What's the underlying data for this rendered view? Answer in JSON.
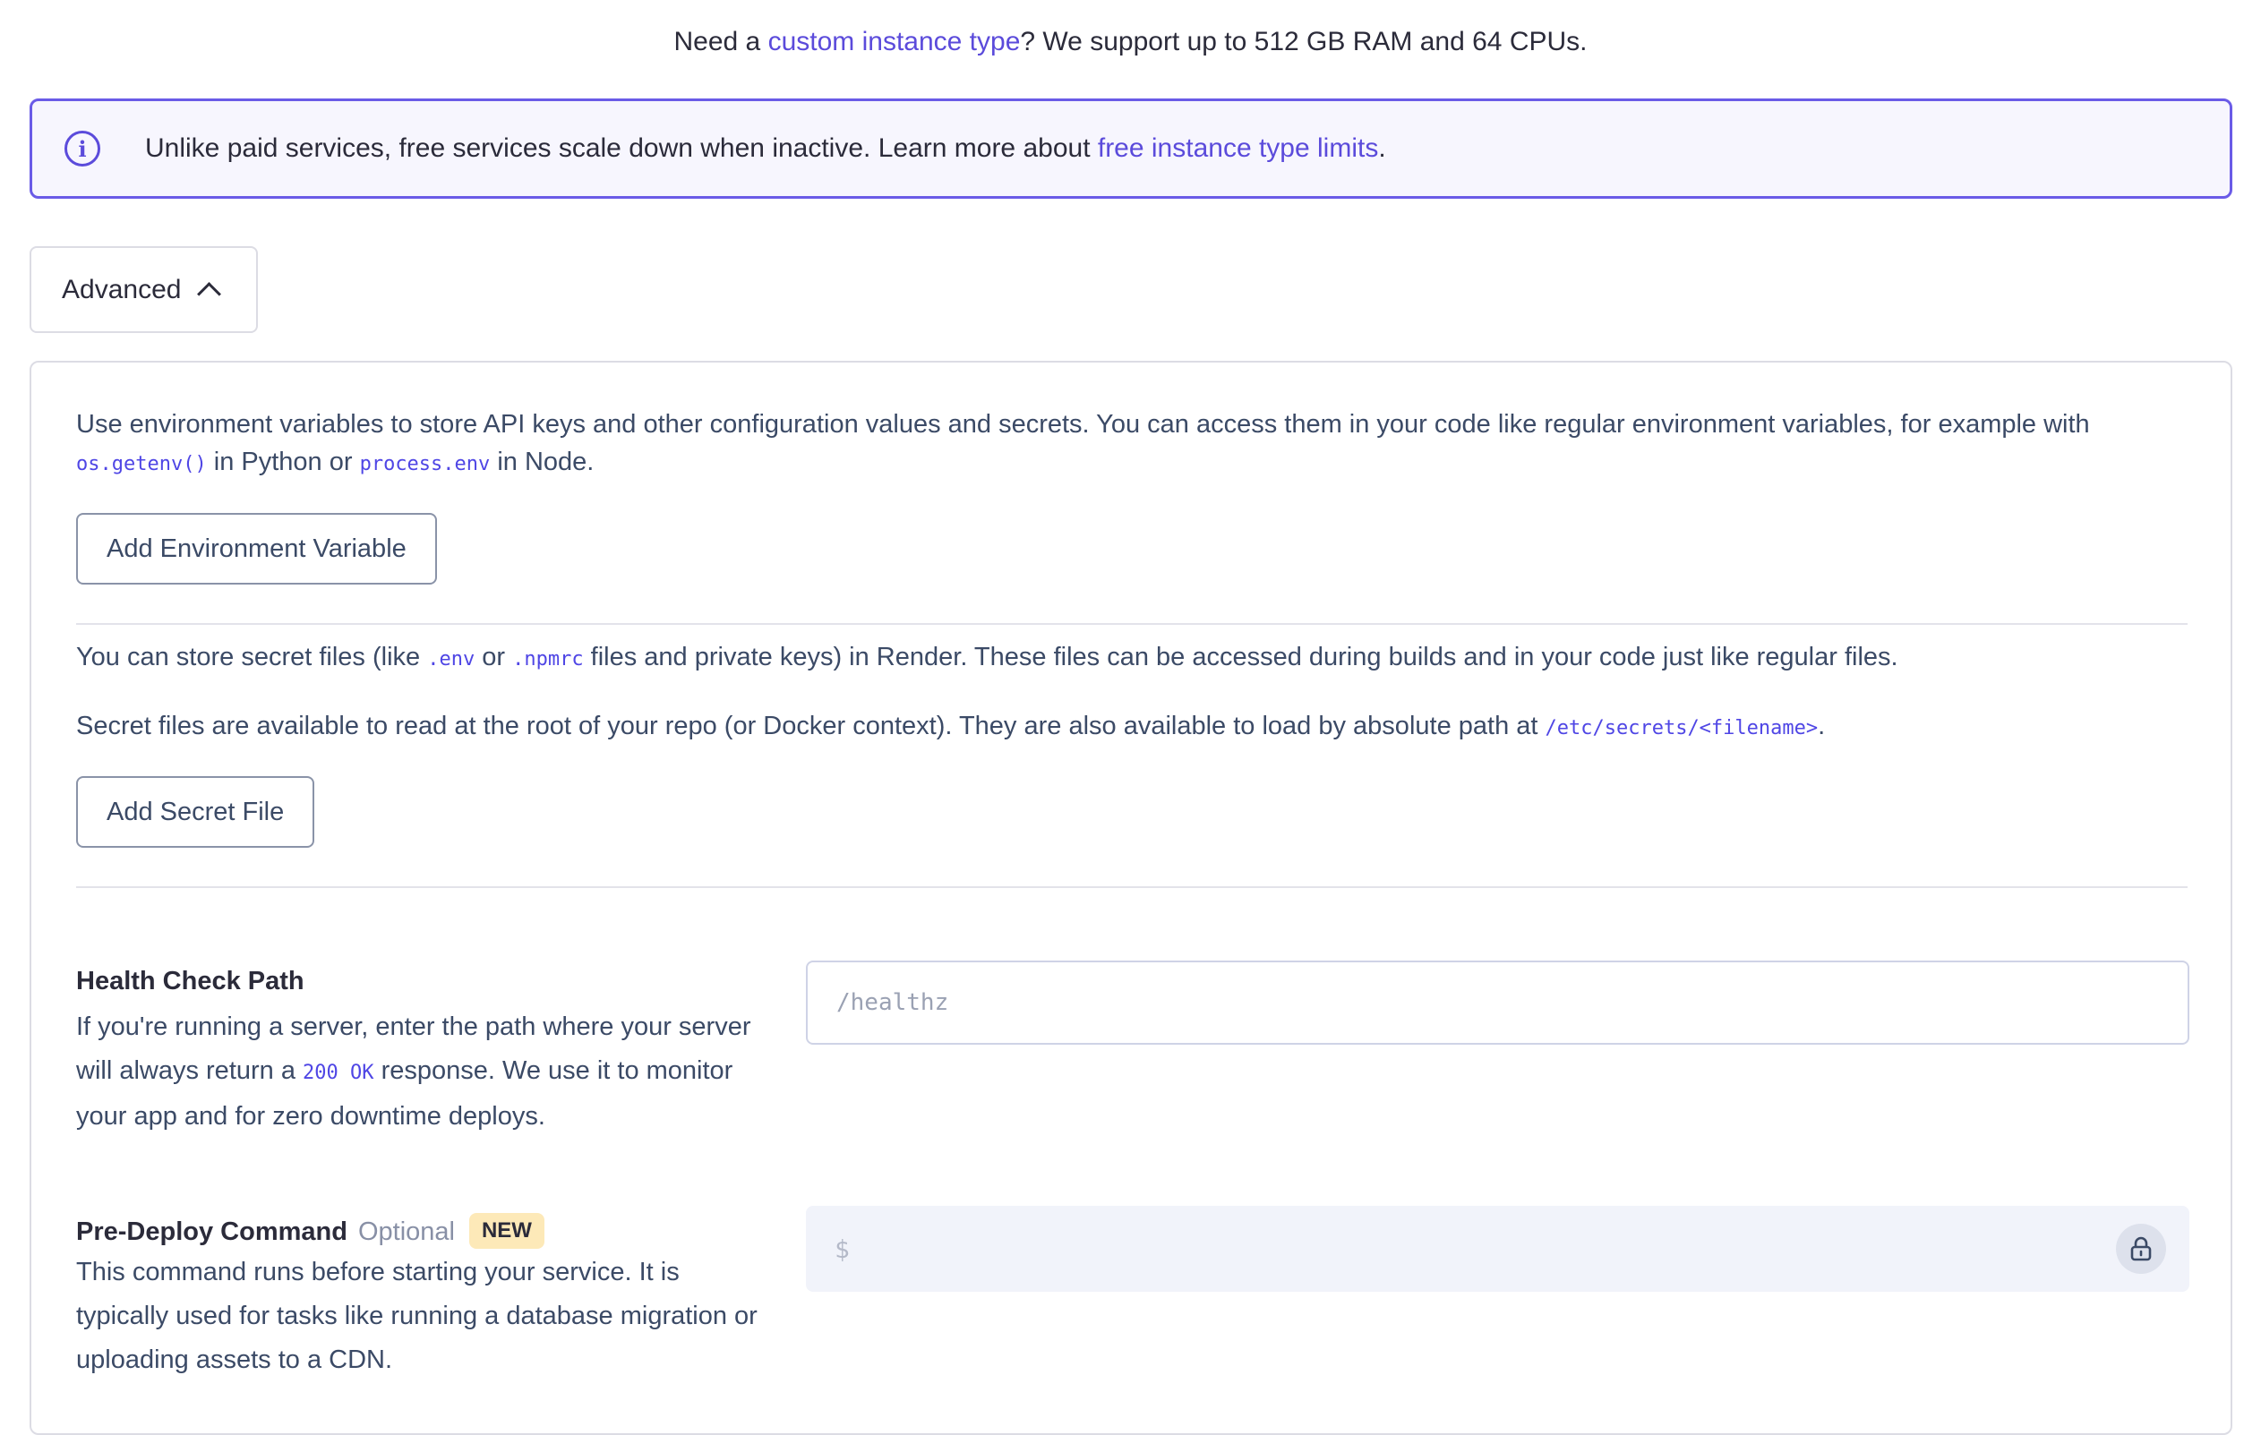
{
  "instance_note": {
    "prefix": "Need a ",
    "link": "custom instance type",
    "suffix": "? We support up to 512 GB RAM and 64 CPUs."
  },
  "info_banner": {
    "icon": "info-icon",
    "icon_glyph": "i",
    "text": "Unlike paid services, free services scale down when inactive. Learn more about ",
    "link": "free instance type limits",
    "suffix": "."
  },
  "advanced": {
    "label": "Advanced",
    "expanded": true
  },
  "env_vars": {
    "text1": "Use environment variables to store API keys and other configuration values and secrets. You can access them in your code like regular environment variables, for example with",
    "code1": "os.getenv()",
    "text2": " in Python or ",
    "code2": "process.env",
    "text3": " in Node.",
    "button": "Add Environment Variable"
  },
  "secret_files": {
    "p1_a": "You can store secret files (like ",
    "p1_code1": ".env",
    "p1_b": " or ",
    "p1_code2": ".npmrc",
    "p1_c": " files and private keys) in Render. These files can be accessed during builds and in your code just like regular files.",
    "p2_a": "Secret files are available to read at the root of your repo (or Docker context). They are also available to load by absolute path at ",
    "p2_code": "/etc/secrets/<filename>",
    "p2_b": ".",
    "button": "Add Secret File"
  },
  "health_check": {
    "label": "Health Check Path",
    "desc_a": "If you're running a server, enter the path where your server will always return a ",
    "desc_code": "200 OK",
    "desc_b": " response. We use it to monitor your app and for zero downtime deploys.",
    "placeholder": "/healthz",
    "value": ""
  },
  "pre_deploy": {
    "label": "Pre-Deploy Command",
    "optional": "Optional",
    "badge": "NEW",
    "desc": "This command runs before starting your service. It is typically used for tasks like running a database migration or uploading assets to a CDN.",
    "prefix": "$",
    "value": "",
    "lock_icon": "lock-icon"
  },
  "colors": {
    "accent": "#5b4bdb",
    "banner_border": "#6a5be7",
    "badge_bg": "#fde9b8",
    "text": "#2b2b3a",
    "muted_text": "#3b4a66"
  }
}
